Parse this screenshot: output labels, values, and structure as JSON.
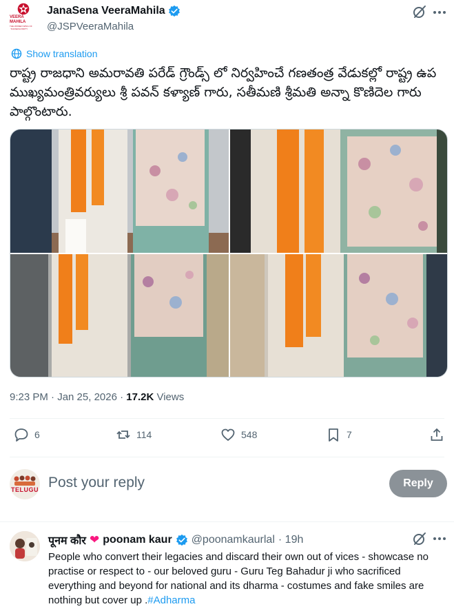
{
  "post": {
    "author_name": "JanaSena VeeraMahila",
    "author_handle": "@JSPVeeraMahila",
    "avatar_text": "VEERA MAHILA",
    "avatar_subtext": "THE WOMEN WING OF JANASENA PARTY",
    "show_translation": "Show translation",
    "text": "రాష్ట్ర రాజధాని అమరావతి పరేడ్ గ్రౌండ్స్ లో నిర్వహించే గణతంత్ర వేడుకల్లో రాష్ట్ర ఉప ముఖ్యమంత్రివర్యులు శ్రీ పవన్ కళ్యాణ్ గారు, సతీమణి శ్రీమతి అన్నా కొణిదెల గారు పాల్గొంటారు.",
    "time": "9:23 PM · Jan 25, 2026 · ",
    "views_count": "17.2K",
    "views_label": " Views",
    "photos_count": 4
  },
  "actions": {
    "replies": "6",
    "reposts": "114",
    "likes": "548",
    "bookmarks": "7"
  },
  "composer": {
    "placeholder": "Post your reply",
    "avatar_text": "TELUGU",
    "reply_button": "Reply"
  },
  "reply": {
    "display_name_hi": "पूनम कौर",
    "heart": "❤",
    "display_name": "poonam kaur",
    "handle": "@poonamkaurlal",
    "time": "· 19h",
    "text": "People who convert their legacies and discard their own out of vices - showcase no practise or respect to - our beloved guru - Guru Teg Bahadur ji who sacrificed everything and beyond for national and its dharma - costumes and fake smiles are nothing but cover up .",
    "hashtag": "#Adharma"
  },
  "colors": {
    "accent": "#1d9bf0",
    "muted": "#536471",
    "reply_button_bg": "#8b9298",
    "heart": "#f91880",
    "saffron": "#f07f1a"
  },
  "icons": [
    "verified-badge-icon",
    "grok-icon",
    "more-icon",
    "translate-icon",
    "reply-icon",
    "repost-icon",
    "like-icon",
    "bookmark-icon",
    "share-icon"
  ]
}
